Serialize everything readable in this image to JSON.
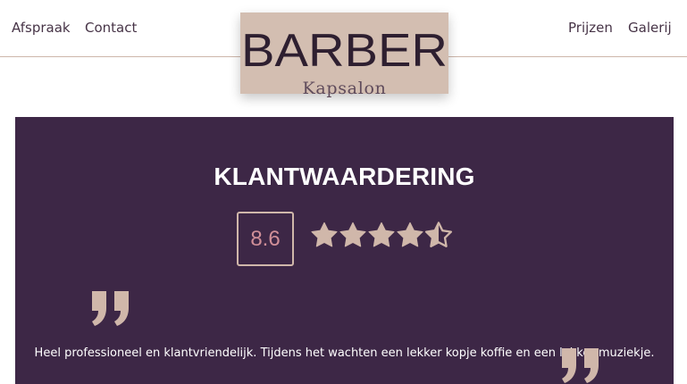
{
  "navigation": {
    "left": [
      {
        "label": "Afspraak"
      },
      {
        "label": "Contact"
      }
    ],
    "right": [
      {
        "label": "Prijzen"
      },
      {
        "label": "Galerij"
      }
    ]
  },
  "logo": {
    "title": "BARBER",
    "subtitle": "Kapsalon",
    "background_color": "#d3beb1",
    "text_color": "#2e1f30"
  },
  "review": {
    "title": "KLANTWAARDERING",
    "score": "8.6",
    "stars": {
      "rating": 4.5,
      "max": 5,
      "icon_name": "star-icon"
    },
    "quote_icon_open": "quote-open-icon",
    "quote_icon_close": "quote-close-icon",
    "text": "Heel professioneel en klantvriendelijk. Tijdens het wachten een lekker kopje koffie en een lekker muziekje.",
    "background_color": "#3d2746",
    "accent_color": "#d0b7aa",
    "score_color": "#d08f98",
    "text_color": "#ffffff"
  }
}
